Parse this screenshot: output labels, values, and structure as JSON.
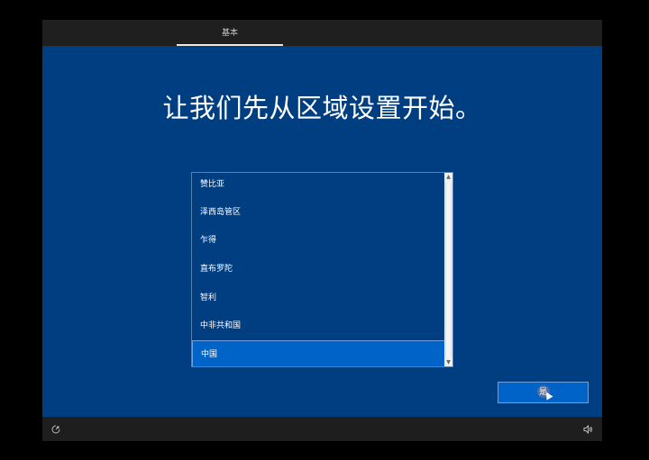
{
  "header": {
    "tab_label": "基本"
  },
  "main": {
    "title": "让我们先从区域设置开始。",
    "regions": [
      "赞比亚",
      "泽西岛管区",
      "乍得",
      "直布罗陀",
      "智利",
      "中非共和国",
      "中国"
    ],
    "selected_region": "中国",
    "yes_button_label": "是"
  },
  "footer": {
    "left_icon": "accessibility-icon",
    "right_icon": "volume-icon"
  },
  "colors": {
    "background": "#003e82",
    "selection": "#0063c8",
    "bars": "#1f1f1f"
  }
}
